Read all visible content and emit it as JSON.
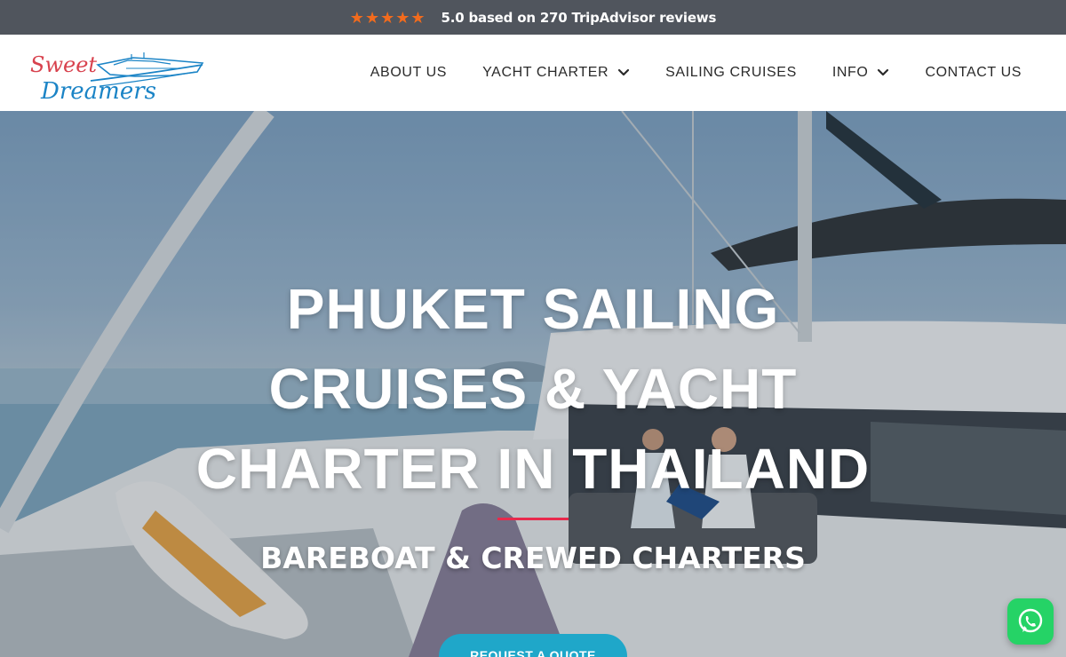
{
  "topbar": {
    "stars": [
      "★",
      "★",
      "★",
      "★",
      "★"
    ],
    "rating_text": "5.0 based on 270 TripAdvisor reviews",
    "star_color": "#f26b1d",
    "bg_color": "#50555d"
  },
  "logo": {
    "line1": "Sweet",
    "line2": "Dreamers",
    "icon": "yacht-logo-icon",
    "colors": {
      "script_red": "#d8424e",
      "script_blue": "#1b84c6"
    }
  },
  "nav": {
    "items": [
      {
        "label": "ABOUT US",
        "dropdown": false
      },
      {
        "label": "YACHT CHARTER",
        "dropdown": true
      },
      {
        "label": "SAILING CRUISES",
        "dropdown": false
      },
      {
        "label": "INFO",
        "dropdown": true
      },
      {
        "label": "CONTACT US",
        "dropdown": false
      }
    ]
  },
  "hero": {
    "title_lines": [
      "PHUKET SAILING",
      "CRUISES & YACHT",
      "CHARTER IN THAILAND"
    ],
    "subtitle": "BAREBOAT & CREWED CHARTERS",
    "cta_label": "REQUEST A QUOTE",
    "accent_color": "#e8294c",
    "cta_color": "#1fa7c9"
  },
  "whatsapp": {
    "icon": "whatsapp-icon",
    "color": "#25d366"
  }
}
